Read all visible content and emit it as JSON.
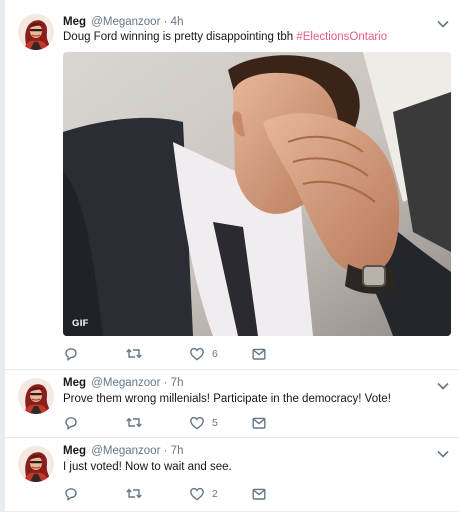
{
  "tweets": [
    {
      "name": "Meg",
      "handle": "@Meganzoor",
      "dot": "·",
      "time": "4h",
      "text": "Doug Ford winning is pretty disappointing tbh ",
      "hashtag": "#ElectionsOntario",
      "media_badge": "GIF",
      "likes": "6"
    },
    {
      "name": "Meg",
      "handle": "@Meganzoor",
      "dot": "·",
      "time": "7h",
      "text": "Prove them wrong millenials! Participate in the democracy! Vote!",
      "likes": "5"
    },
    {
      "name": "Meg",
      "handle": "@Meganzoor",
      "dot": "·",
      "time": "7h",
      "text": "I just voted! Now to wait and see.",
      "likes": "2"
    }
  ],
  "icons": {
    "reply": "reply-icon",
    "retweet": "retweet-icon",
    "like": "heart-icon",
    "dm": "direct-message-icon",
    "caret": "chevron-down-icon"
  },
  "colors": {
    "accent_blue": "#1da1f2",
    "hashtag": "#e0245e",
    "icon_gray": "#657786"
  }
}
